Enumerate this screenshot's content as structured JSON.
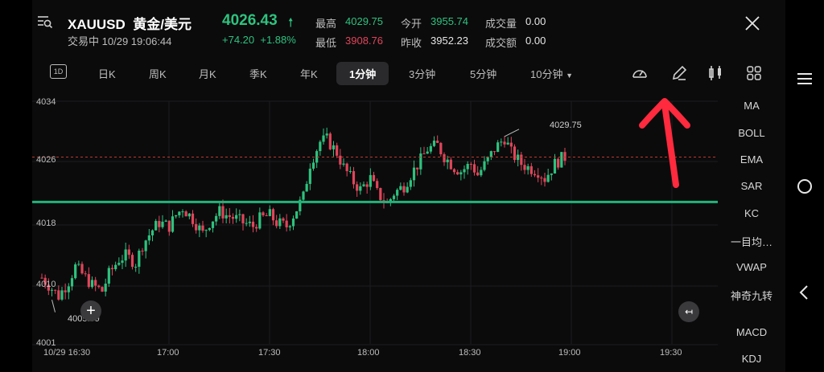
{
  "header": {
    "symbol": "XAUUSD",
    "name": "黄金/美元",
    "status": "交易中",
    "datetime": "10/29 19:06:44",
    "price": "4026.43",
    "change": "+74.20",
    "change_pct": "+1.88%",
    "high_label": "最高",
    "high_value": "4029.75",
    "low_label": "最低",
    "low_value": "3908.76",
    "open_label": "今开",
    "open_value": "3955.74",
    "prev_close_label": "昨收",
    "prev_close_value": "3952.23",
    "volume_label": "成交量",
    "volume_value": "0.00",
    "turnover_label": "成交额",
    "turnover_value": "0.00"
  },
  "toolbar": {
    "badge": "1D",
    "timeframes": [
      "日K",
      "周K",
      "月K",
      "季K",
      "年K",
      "1分钟",
      "3分钟",
      "5分钟",
      "10分钟"
    ],
    "active_timeframe": "1分钟"
  },
  "indicators": [
    "MA",
    "BOLL",
    "EMA",
    "SAR",
    "KC",
    "一目均…",
    "VWAP",
    "神奇九转",
    "MACD",
    "KDJ"
  ],
  "colors": {
    "up": "#2ec27e",
    "down": "#e0455a",
    "background": "#0b0b0c",
    "annotation": "#ff2a3d"
  },
  "chart_data": {
    "type": "candlestick",
    "yticks": [
      "4034",
      "4026",
      "4018",
      "4010",
      "4001"
    ],
    "xticks": [
      "10/29 16:30",
      "17:00",
      "17:30",
      "18:00",
      "18:30",
      "19:00",
      "19:30"
    ],
    "ylim": [
      4001,
      4034
    ],
    "current_price_line": 4026.4,
    "horizontal_line": 4020.3,
    "max_label": "4029.75",
    "min_label": "4005.99",
    "close_path": [
      [
        "16:30",
        4010.0
      ],
      [
        "16:33",
        4008.5
      ],
      [
        "16:35",
        4007.5
      ],
      [
        "16:38",
        4009.5
      ],
      [
        "16:40",
        4011.5
      ],
      [
        "16:42",
        4010.5
      ],
      [
        "16:45",
        4009.0
      ],
      [
        "16:48",
        4008.2
      ],
      [
        "16:50",
        4010.5
      ],
      [
        "16:53",
        4012.5
      ],
      [
        "16:55",
        4013.0
      ],
      [
        "16:58",
        4012.0
      ],
      [
        "17:00",
        4014.5
      ],
      [
        "17:03",
        4016.5
      ],
      [
        "17:05",
        4017.5
      ],
      [
        "17:08",
        4017.0
      ],
      [
        "17:10",
        4018.5
      ],
      [
        "17:12",
        4019.5
      ],
      [
        "17:15",
        4018.0
      ],
      [
        "17:18",
        4016.0
      ],
      [
        "17:20",
        4017.5
      ],
      [
        "17:23",
        4019.0
      ],
      [
        "17:25",
        4018.5
      ],
      [
        "17:28",
        4018.0
      ],
      [
        "17:30",
        4017.5
      ],
      [
        "17:33",
        4017.0
      ],
      [
        "17:35",
        4018.0
      ],
      [
        "17:38",
        4018.5
      ],
      [
        "17:40",
        4017.5
      ],
      [
        "17:43",
        4017.0
      ],
      [
        "17:45",
        4018.5
      ],
      [
        "17:48",
        4021.0
      ],
      [
        "17:50",
        4025.5
      ],
      [
        "17:53",
        4028.5
      ],
      [
        "17:55",
        4028.8
      ],
      [
        "17:58",
        4027.0
      ],
      [
        "18:00",
        4025.0
      ],
      [
        "18:03",
        4023.0
      ],
      [
        "18:05",
        4022.0
      ],
      [
        "18:08",
        4023.5
      ],
      [
        "18:10",
        4021.5
      ],
      [
        "18:13",
        4020.0
      ],
      [
        "18:15",
        4021.5
      ],
      [
        "18:18",
        4022.5
      ],
      [
        "18:20",
        4024.0
      ],
      [
        "18:23",
        4026.0
      ],
      [
        "18:25",
        4027.5
      ],
      [
        "18:28",
        4028.0
      ],
      [
        "18:30",
        4026.5
      ],
      [
        "18:33",
        4025.0
      ],
      [
        "18:35",
        4024.5
      ],
      [
        "18:38",
        4025.5
      ],
      [
        "18:40",
        4024.0
      ],
      [
        "18:43",
        4026.0
      ],
      [
        "18:45",
        4027.5
      ],
      [
        "18:48",
        4029.0
      ],
      [
        "18:50",
        4027.0
      ],
      [
        "18:53",
        4025.5
      ],
      [
        "18:55",
        4025.0
      ],
      [
        "18:58",
        4024.5
      ],
      [
        "19:00",
        4023.5
      ],
      [
        "19:03",
        4025.5
      ],
      [
        "19:05",
        4026.2
      ],
      [
        "19:06",
        4026.4
      ]
    ]
  }
}
